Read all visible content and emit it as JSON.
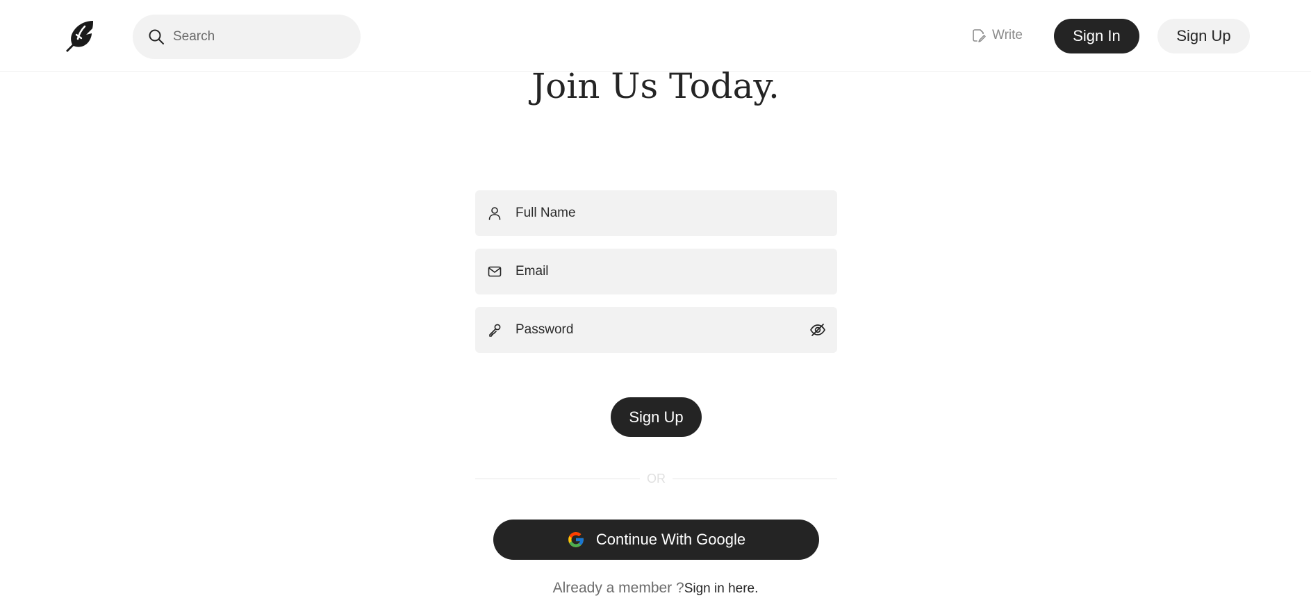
{
  "navbar": {
    "logo_icon": "feather-icon",
    "search": {
      "placeholder": "Search",
      "value": "",
      "icon": "search-icon"
    },
    "write_label": "Write",
    "write_icon": "edit-note-icon",
    "signin_label": "Sign In",
    "signup_label": "Sign Up"
  },
  "main": {
    "title": "Join Us Today.",
    "fields": {
      "full_name": {
        "placeholder": "Full Name",
        "value": "",
        "icon": "user-icon"
      },
      "email": {
        "placeholder": "Email",
        "value": "",
        "icon": "mail-icon"
      },
      "password": {
        "placeholder": "Password",
        "value": "",
        "icon": "key-icon",
        "toggle_icon": "eye-off-icon"
      }
    },
    "signup_label": "Sign Up",
    "divider_text": "OR",
    "google_label": "Continue With Google",
    "google_icon": "google-icon",
    "member_text": "Already a member ?",
    "signin_link": "Sign in here."
  },
  "colors": {
    "primary": "#242424",
    "input_bg": "#f2f2f2",
    "muted_text": "#6b6b6b",
    "divider": "#e6e6e6"
  }
}
